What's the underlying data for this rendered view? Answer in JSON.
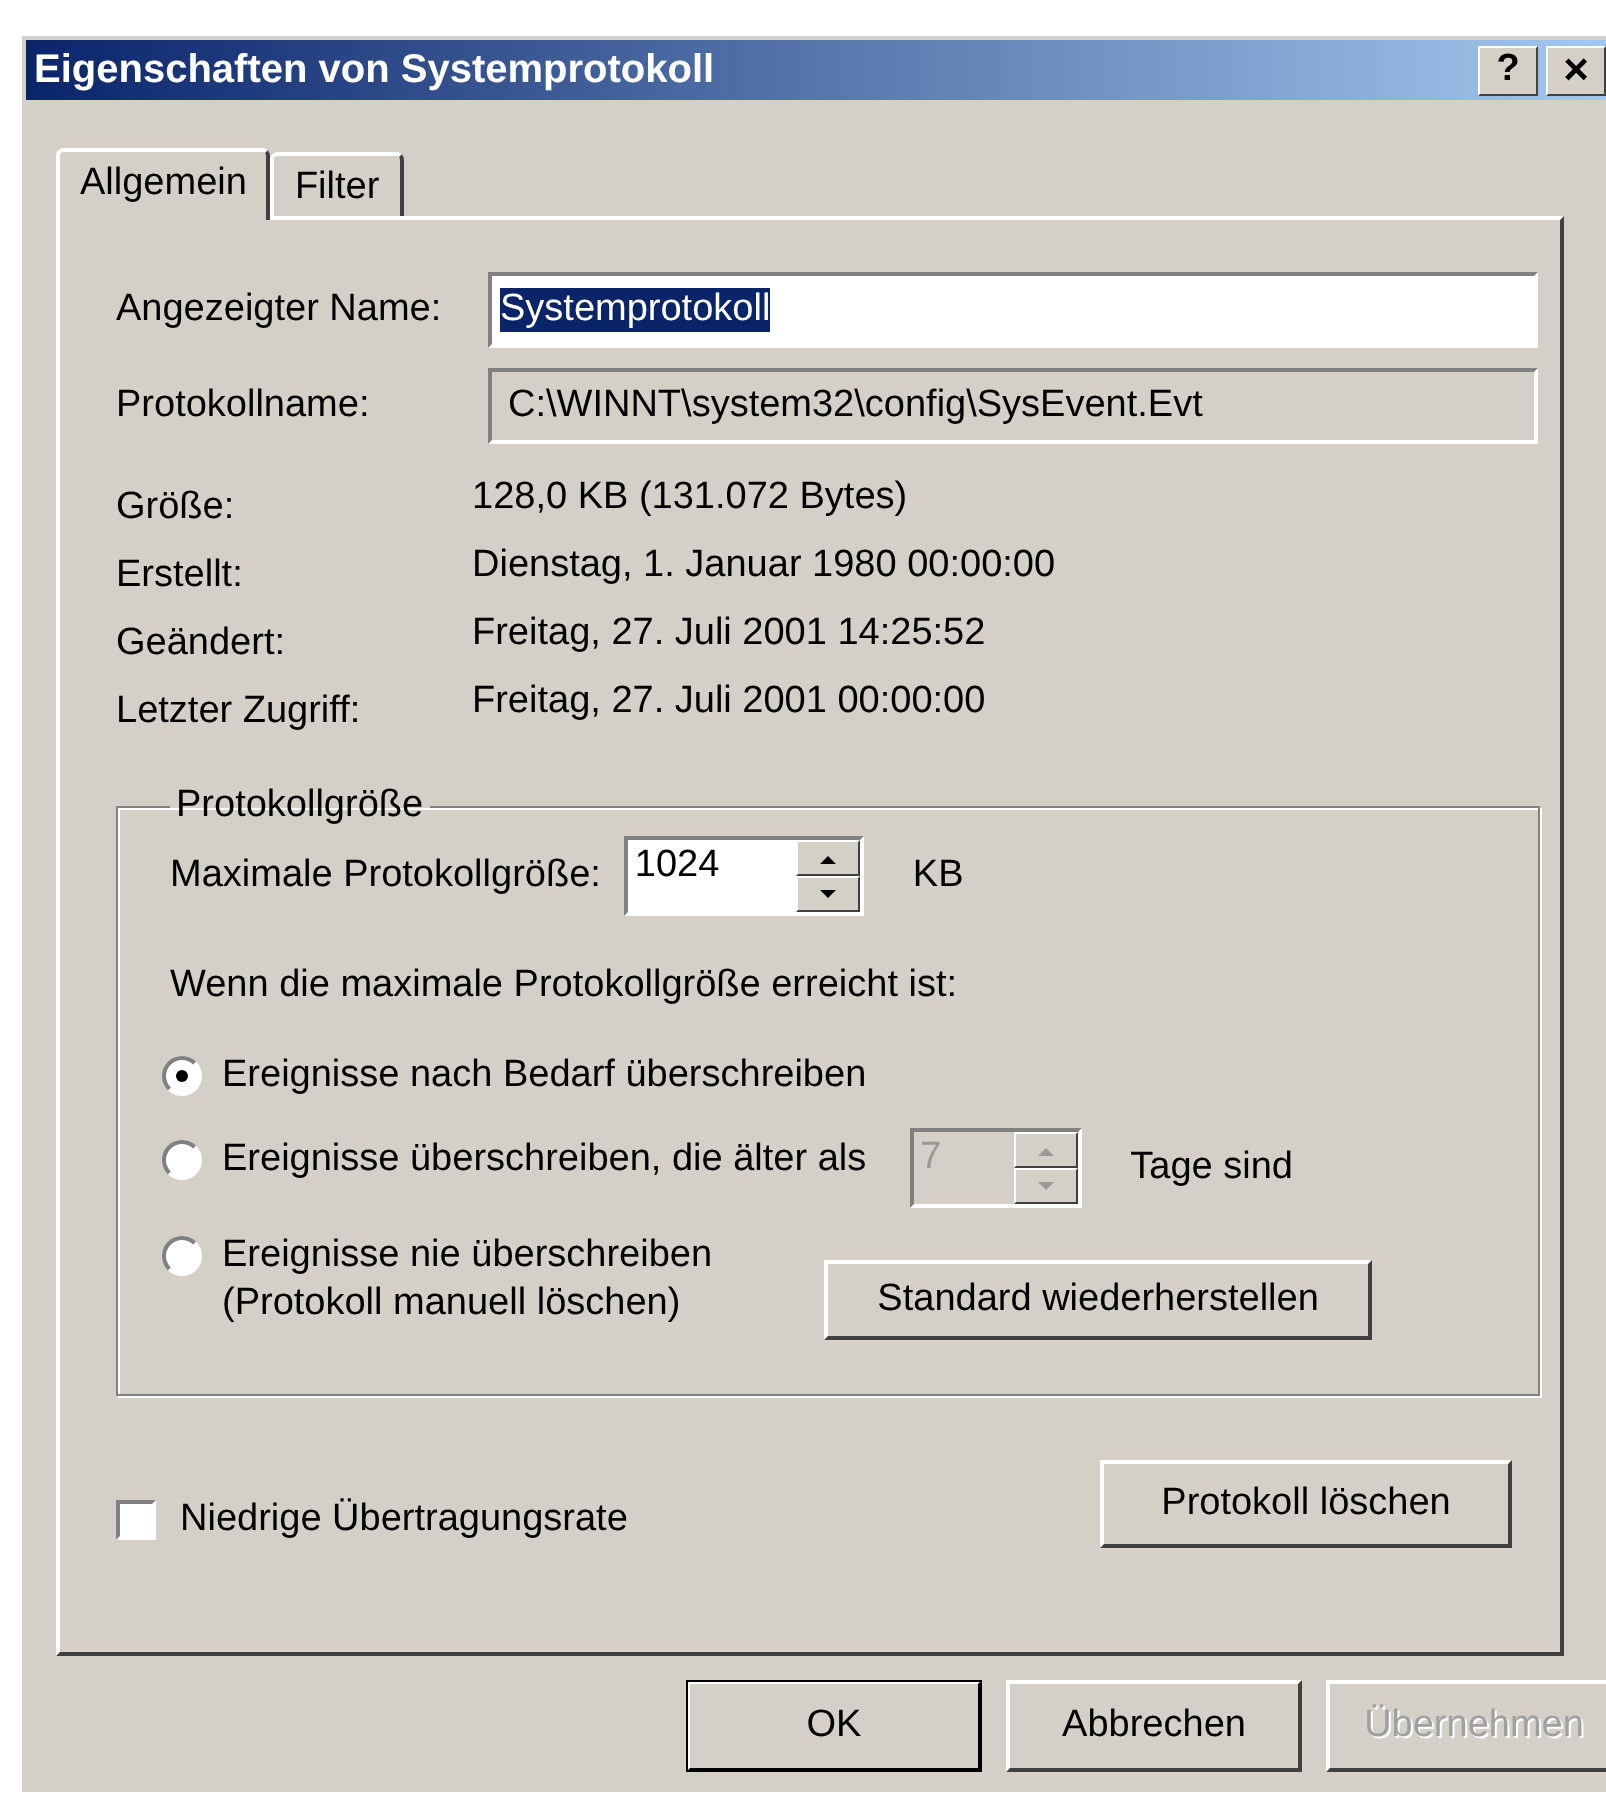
{
  "window": {
    "title": "Eigenschaften von Systemprotokoll",
    "title_buttons": [
      {
        "kind": "help",
        "label": "?"
      },
      {
        "kind": "close",
        "label": "×"
      }
    ]
  },
  "tabs": [
    {
      "label": "Allgemein",
      "selected": true
    },
    {
      "label": "Filter",
      "selected": false
    }
  ],
  "fields": [
    {
      "label": "Angezeigter Name:",
      "value": "Systemprotokoll",
      "text_selected": true,
      "readonly": false
    },
    {
      "label": "Protokollname:",
      "value": "C:\\WINNT\\system32\\config\\SysEvent.Evt",
      "text_selected": false,
      "readonly": true
    }
  ],
  "info": [
    {
      "label": "Größe:",
      "value": "128,0 KB (131.072 Bytes)"
    },
    {
      "label": "Erstellt:",
      "value": "Dienstag, 1. Januar 1980 00:00:00"
    },
    {
      "label": "Geändert:",
      "value": "Freitag, 27. Juli 2001 14:25:52"
    },
    {
      "label": "Letzter Zugriff:",
      "value": "Freitag, 27. Juli 2001 00:00:00"
    }
  ],
  "log_size": {
    "legend": "Protokollgröße",
    "max_label": "Maximale Protokollgröße:",
    "max_value": "1024",
    "max_unit": "KB",
    "prompt": "Wenn die maximale Protokollgröße erreicht ist:",
    "options": [
      {
        "label": "Ereignisse nach Bedarf überschreiben",
        "selected": true
      },
      {
        "label": "Ereignisse überschreiben, die älter als",
        "selected": false,
        "days": {
          "value": "7",
          "disabled": true,
          "unit": "Tage sind"
        }
      },
      {
        "label": "Ereignisse nie überschreiben\n(Protokoll manuell löschen)",
        "selected": false
      }
    ],
    "restore_button": "Standard wiederherstellen"
  },
  "low_speed": {
    "label": "Niedrige Übertragungsrate",
    "checked": false
  },
  "clear_button": "Protokoll löschen",
  "buttons": [
    {
      "label": "OK",
      "default": true,
      "disabled": false
    },
    {
      "label": "Abbrechen",
      "default": false,
      "disabled": false
    },
    {
      "label": "Übernehmen",
      "default": false,
      "disabled": true
    }
  ]
}
